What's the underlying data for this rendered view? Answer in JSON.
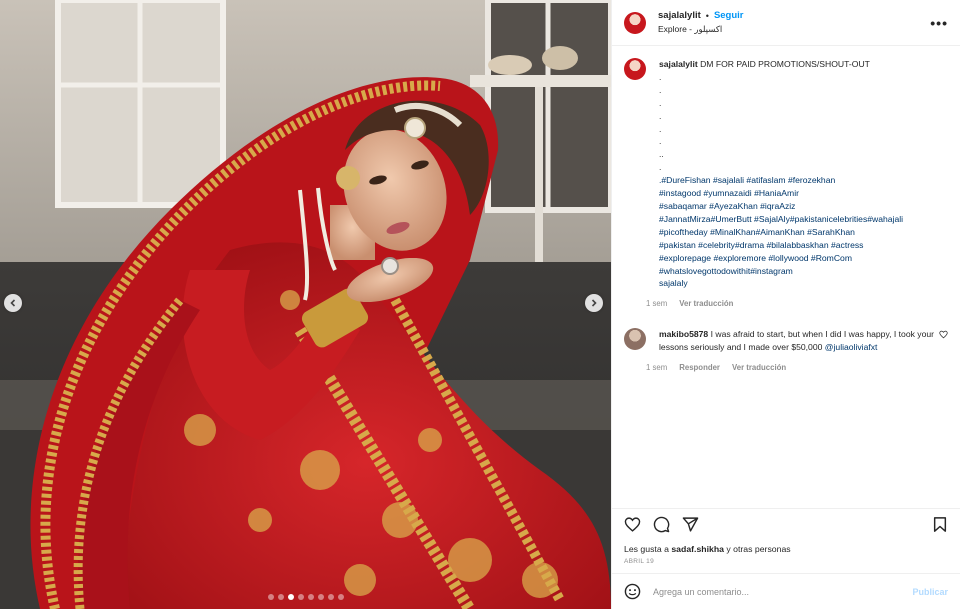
{
  "post": {
    "username": "sajalalylit",
    "separator": "•",
    "follow_label": "Seguir",
    "location": "Explore - اکسپلور",
    "more_label": "•••"
  },
  "caption": {
    "username": "sajalalylit",
    "first_line": "DM FOR PAID PROMOTIONS/SHOUT-OUT",
    "dot_lines": [
      ".",
      ".",
      ".",
      ".",
      ".",
      ".",
      "..",
      "."
    ],
    "hashtag_lines": [
      ".#DureFishan #sajalali #atifaslam #ferozekhan",
      "#instagood #yumnazaidi #HaniaAmir",
      "#sabaqamar #AyezaKhan #iqraAziz",
      "#JannatMirza#UmerButt #SajalAly#pakistanicelebrities#wahajali",
      "#picoftheday #MinalKhan#AimanKhan #SarahKhan",
      "#pakistan #celebrity#drama #bilalabbaskhan #actress",
      "#explorepage #exploremore #lollywood #RomCom",
      "#whatslovegottodowithit#instagram",
      "sajalaly"
    ],
    "time": "1 sem",
    "translate_label": "Ver traducción"
  },
  "comment": {
    "username": "makibo5878",
    "text": "I was afraid to start, but when I did I was happy, I took your lessons seriously and I made over $50,000",
    "mention": "@juliaoliviafxt",
    "time": "1 sem",
    "reply_label": "Responder",
    "translate_label": "Ver traducción"
  },
  "likes": {
    "prefix": "Les gusta a",
    "user": "sadaf.shikha",
    "suffix": "y otras personas"
  },
  "date": "ABRIL 19",
  "add_comment": {
    "placeholder": "Agrega un comentario...",
    "publish_label": "Publicar"
  },
  "carousel": {
    "dot_count": 8,
    "active_index": 2
  },
  "icons": {
    "heart": "heart-icon",
    "comment": "comment-icon",
    "share": "share-icon",
    "save": "bookmark-icon",
    "emoji": "emoji-icon",
    "prev": "chevron-left-icon",
    "next": "chevron-right-icon"
  },
  "colors": {
    "link_blue": "#0095f6",
    "hashtag": "#00376b",
    "muted": "#8e8e8e",
    "publish_disabled": "#b3dbff"
  }
}
